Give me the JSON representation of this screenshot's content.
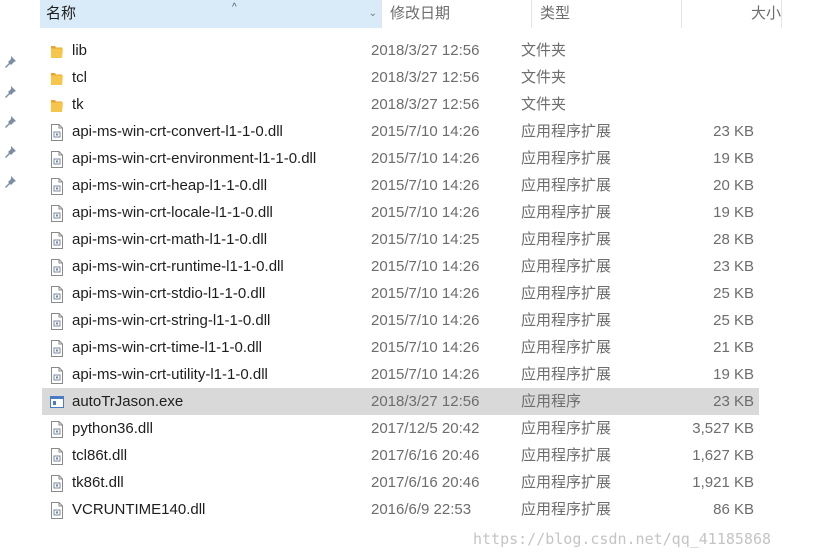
{
  "columns": {
    "name": "名称",
    "date": "修改日期",
    "type": "类型",
    "size": "大小"
  },
  "files": [
    {
      "name": "lib",
      "date": "2018/3/27 12:56",
      "type": "文件夹",
      "size": "",
      "icon": "folder-icon"
    },
    {
      "name": "tcl",
      "date": "2018/3/27 12:56",
      "type": "文件夹",
      "size": "",
      "icon": "folder-icon"
    },
    {
      "name": "tk",
      "date": "2018/3/27 12:56",
      "type": "文件夹",
      "size": "",
      "icon": "folder-icon"
    },
    {
      "name": "api-ms-win-crt-convert-l1-1-0.dll",
      "date": "2015/7/10 14:26",
      "type": "应用程序扩展",
      "size": "23 KB",
      "icon": "dll-file-icon"
    },
    {
      "name": "api-ms-win-crt-environment-l1-1-0.dll",
      "date": "2015/7/10 14:26",
      "type": "应用程序扩展",
      "size": "19 KB",
      "icon": "dll-file-icon"
    },
    {
      "name": "api-ms-win-crt-heap-l1-1-0.dll",
      "date": "2015/7/10 14:26",
      "type": "应用程序扩展",
      "size": "20 KB",
      "icon": "dll-file-icon"
    },
    {
      "name": "api-ms-win-crt-locale-l1-1-0.dll",
      "date": "2015/7/10 14:26",
      "type": "应用程序扩展",
      "size": "19 KB",
      "icon": "dll-file-icon"
    },
    {
      "name": "api-ms-win-crt-math-l1-1-0.dll",
      "date": "2015/7/10 14:25",
      "type": "应用程序扩展",
      "size": "28 KB",
      "icon": "dll-file-icon"
    },
    {
      "name": "api-ms-win-crt-runtime-l1-1-0.dll",
      "date": "2015/7/10 14:26",
      "type": "应用程序扩展",
      "size": "23 KB",
      "icon": "dll-file-icon"
    },
    {
      "name": "api-ms-win-crt-stdio-l1-1-0.dll",
      "date": "2015/7/10 14:26",
      "type": "应用程序扩展",
      "size": "25 KB",
      "icon": "dll-file-icon"
    },
    {
      "name": "api-ms-win-crt-string-l1-1-0.dll",
      "date": "2015/7/10 14:26",
      "type": "应用程序扩展",
      "size": "25 KB",
      "icon": "dll-file-icon"
    },
    {
      "name": "api-ms-win-crt-time-l1-1-0.dll",
      "date": "2015/7/10 14:26",
      "type": "应用程序扩展",
      "size": "21 KB",
      "icon": "dll-file-icon"
    },
    {
      "name": "api-ms-win-crt-utility-l1-1-0.dll",
      "date": "2015/7/10 14:26",
      "type": "应用程序扩展",
      "size": "19 KB",
      "icon": "dll-file-icon"
    },
    {
      "name": "autoTrJason.exe",
      "date": "2018/3/27 12:56",
      "type": "应用程序",
      "size": "23 KB",
      "icon": "exe-file-icon",
      "selected": true
    },
    {
      "name": "python36.dll",
      "date": "2017/12/5 20:42",
      "type": "应用程序扩展",
      "size": "3,527 KB",
      "icon": "dll-file-icon"
    },
    {
      "name": "tcl86t.dll",
      "date": "2017/6/16 20:46",
      "type": "应用程序扩展",
      "size": "1,627 KB",
      "icon": "dll-file-icon"
    },
    {
      "name": "tk86t.dll",
      "date": "2017/6/16 20:46",
      "type": "应用程序扩展",
      "size": "1,921 KB",
      "icon": "dll-file-icon"
    },
    {
      "name": "VCRUNTIME140.dll",
      "date": "2016/6/9 22:53",
      "type": "应用程序扩展",
      "size": "86 KB",
      "icon": "dll-file-icon"
    }
  ],
  "watermark": "https://blog.csdn.net/qq_41185868",
  "colors": {
    "header_selected": "#d9ebf9",
    "row_selected": "#d9d9d9",
    "folder": "#f6c54b",
    "header_text": "#4c607a"
  }
}
